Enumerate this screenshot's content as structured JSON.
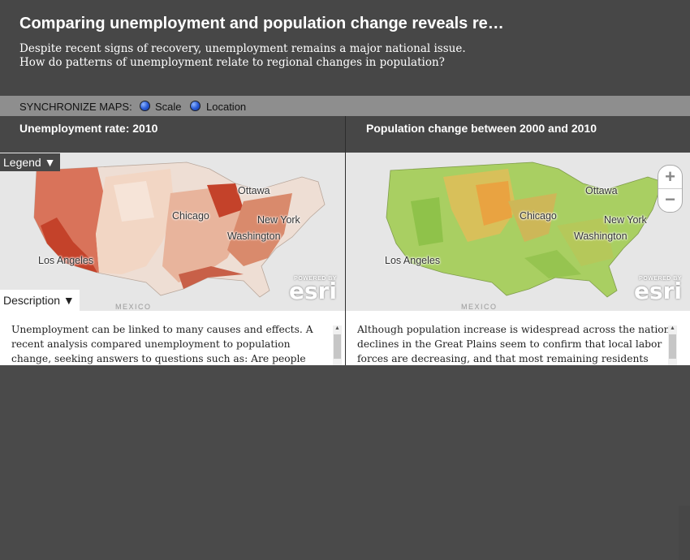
{
  "header": {
    "title": "Comparing unemployment and population change reveals re…",
    "subtitle": "Despite recent signs of recovery, unemployment remains a major national issue. How do patterns of unemployment relate to regional changes in population?"
  },
  "sync": {
    "label": "SYNCHRONIZE MAPS:",
    "options": [
      "Scale",
      "Location"
    ]
  },
  "left_pane": {
    "title": "Unemployment rate: 2010",
    "legend_button": "Legend ▼",
    "description_button": "Description ▼",
    "text": "Unemployment can be linked to many causes and effects. A recent analysis compared unemployment to population change, seeking answers to questions such as: Are people leaving areas of"
  },
  "right_pane": {
    "title": "Population change between 2000 and 2010",
    "text": "Although population increase is widespread across the nation, declines in the Great Plains seem to confirm that local labor forces are decreasing, and that most remaining residents have"
  },
  "map_labels": {
    "cities": [
      "Ottawa",
      "Chicago",
      "New York",
      "Washington",
      "Los Angeles"
    ],
    "mexico": "MEXICO",
    "powered_by": "POWERED BY",
    "esri": "esri"
  },
  "zoom": {
    "in": "+",
    "out": "−"
  },
  "colors": {
    "header": "#474747",
    "syncbar": "#8e8e8e",
    "map_bg": "#e6e6e6",
    "unemployment_dark": "#c4422a",
    "unemployment_light": "#f2d6c4",
    "population_green": "#9ccc52",
    "population_orange": "#e9a341"
  },
  "icons": [
    "radio-selected-icon",
    "chevron-down-icon",
    "zoom-in-icon",
    "zoom-out-icon",
    "scroll-up-icon"
  ]
}
